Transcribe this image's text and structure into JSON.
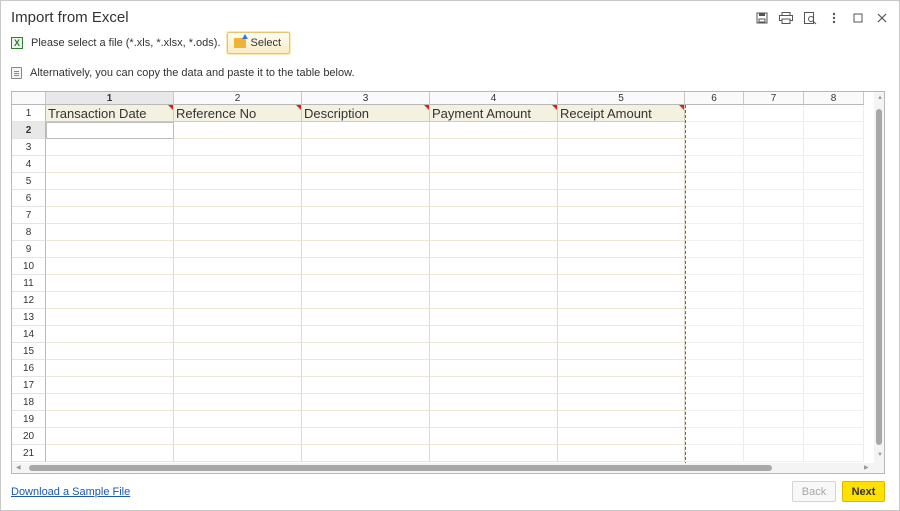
{
  "window": {
    "title": "Import from Excel",
    "controls": [
      "save-icon",
      "print-icon",
      "preview-icon",
      "more-icon",
      "maximize-icon",
      "close-icon"
    ]
  },
  "file_row": {
    "icon": "excel-icon",
    "label": "Please select a file (*.xls, *.xlsx, *.ods).",
    "select_label": "Select"
  },
  "paste_row": {
    "icon": "paste-icon",
    "label": "Alternatively, you can copy the data and paste it to the table below."
  },
  "grid": {
    "column_numbers": [
      "1",
      "2",
      "3",
      "4",
      "5",
      "6",
      "7",
      "8"
    ],
    "header_titles": [
      "Transaction Date",
      "Reference No",
      "Description",
      "Payment Amount",
      "Receipt Amount"
    ],
    "row_numbers": [
      "1",
      "2",
      "3",
      "4",
      "5",
      "6",
      "7",
      "8",
      "9",
      "10",
      "11",
      "12",
      "13",
      "14",
      "15",
      "16",
      "17",
      "18",
      "19",
      "20",
      "21"
    ],
    "active_row": "2",
    "active_column": "1"
  },
  "footer": {
    "download_label": "Download a Sample File",
    "back_label": "Back",
    "next_label": "Next"
  },
  "colors": {
    "accent_next": "#ffe100",
    "header_fill": "#f4f1e1",
    "link": "#1a55c4"
  }
}
